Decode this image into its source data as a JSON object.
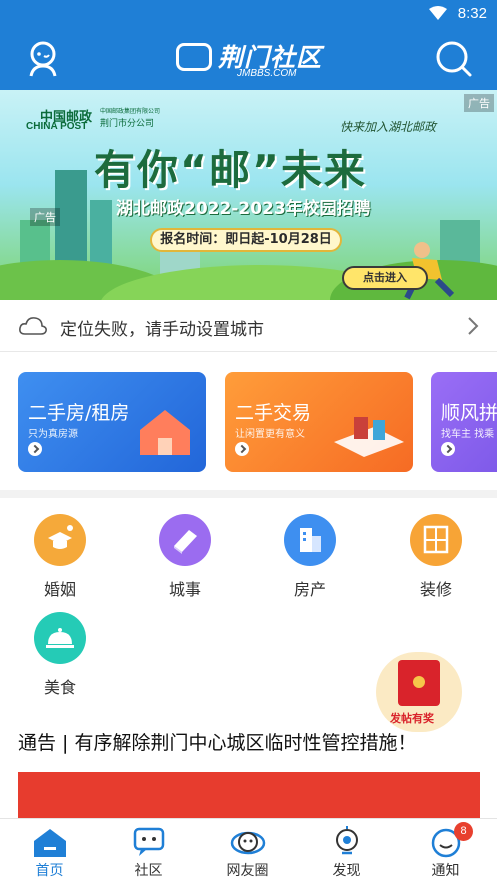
{
  "status_bar": {
    "time": "8:32"
  },
  "header": {
    "logo_name": "荆门社区",
    "logo_domain": "JMBBS.COM"
  },
  "banner": {
    "ad_label": "广告",
    "ad_label_2": "广告",
    "brand_cn": "中国邮政",
    "brand_en": "CHINA POST",
    "brand_group": "中国邮政集团有限公司",
    "brand_branch": "荆门市分公司",
    "tagline": "快来加入湖北邮政",
    "headline": "有你“邮”未来",
    "subline": "湖北邮政2022-2023年校园招聘",
    "date_text": "报名时间：即日起-10月28日",
    "enter_button": "点击进入"
  },
  "location": {
    "text": "定位失败，请手动设置城市"
  },
  "cards": [
    {
      "title": "二手房/租房",
      "sub": "只为真房源"
    },
    {
      "title": "二手交易",
      "sub": "让闲置更有意义"
    },
    {
      "title": "顺风拼",
      "sub": "找车主 找乘"
    }
  ],
  "categories": [
    {
      "label": "婚姻",
      "icon": "hat-icon",
      "color": "#f5a93a"
    },
    {
      "label": "城事",
      "icon": "book-icon",
      "color": "#9b6cf0"
    },
    {
      "label": "房产",
      "icon": "building-icon",
      "color": "#3e8ff0"
    },
    {
      "label": "装修",
      "icon": "cabinet-icon",
      "color": "#f7a436"
    },
    {
      "label": "美食",
      "icon": "dish-icon",
      "color": "#25cbb6"
    }
  ],
  "red_packet": {
    "label": "发帖有奖"
  },
  "notice": {
    "text": "通告 | 有序解除荆门中心城区临时性管控措施！"
  },
  "tabbar": [
    {
      "label": "首页",
      "active": true
    },
    {
      "label": "社区"
    },
    {
      "label": "网友圈"
    },
    {
      "label": "发现"
    },
    {
      "label": "通知",
      "badge": "8"
    }
  ],
  "colors": {
    "brand_blue": "#1f7fd6",
    "notice_red": "#e73c2e"
  }
}
